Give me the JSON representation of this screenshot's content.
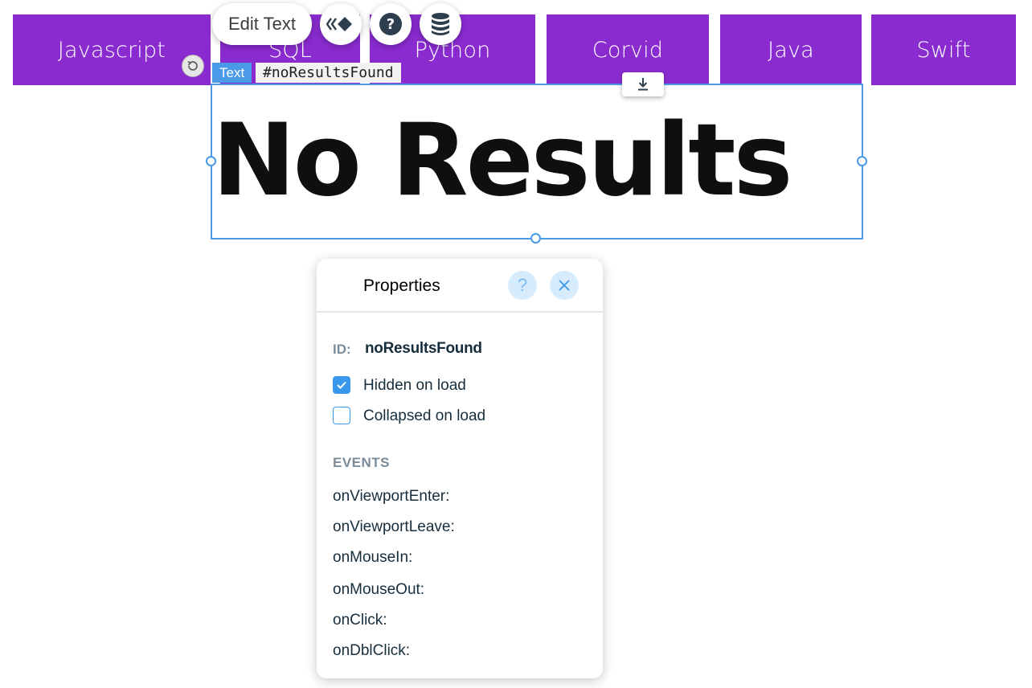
{
  "nav": {
    "items": [
      {
        "label": "Javascript"
      },
      {
        "label": "SQL"
      },
      {
        "label": "Python"
      },
      {
        "label": "Corvid"
      },
      {
        "label": "Java"
      },
      {
        "label": "Swift"
      }
    ]
  },
  "toolbar": {
    "edit_text_label": "Edit Text",
    "icons": [
      "animation-icon",
      "help-icon",
      "database-icon"
    ]
  },
  "element_tag": {
    "type": "Text",
    "id": "#noResultsFound"
  },
  "heading": {
    "text": "No Results"
  },
  "properties": {
    "title": "Properties",
    "help_glyph": "?",
    "id_label": "ID:",
    "id_value": "noResultsFound",
    "hidden_on_load": {
      "label": "Hidden on load",
      "checked": true
    },
    "collapsed_on_load": {
      "label": "Collapsed on load",
      "checked": false
    },
    "events_title": "EVENTS",
    "events": [
      "onViewportEnter:",
      "onViewportLeave:",
      "onMouseIn:",
      "onMouseOut:",
      "onClick:",
      "onDblClick:"
    ]
  },
  "colors": {
    "nav_background": "#8a2bd0",
    "selection": "#4a9ae8",
    "checkbox": "#3899ec",
    "panel_icon_bg": "#d6ebfc"
  }
}
